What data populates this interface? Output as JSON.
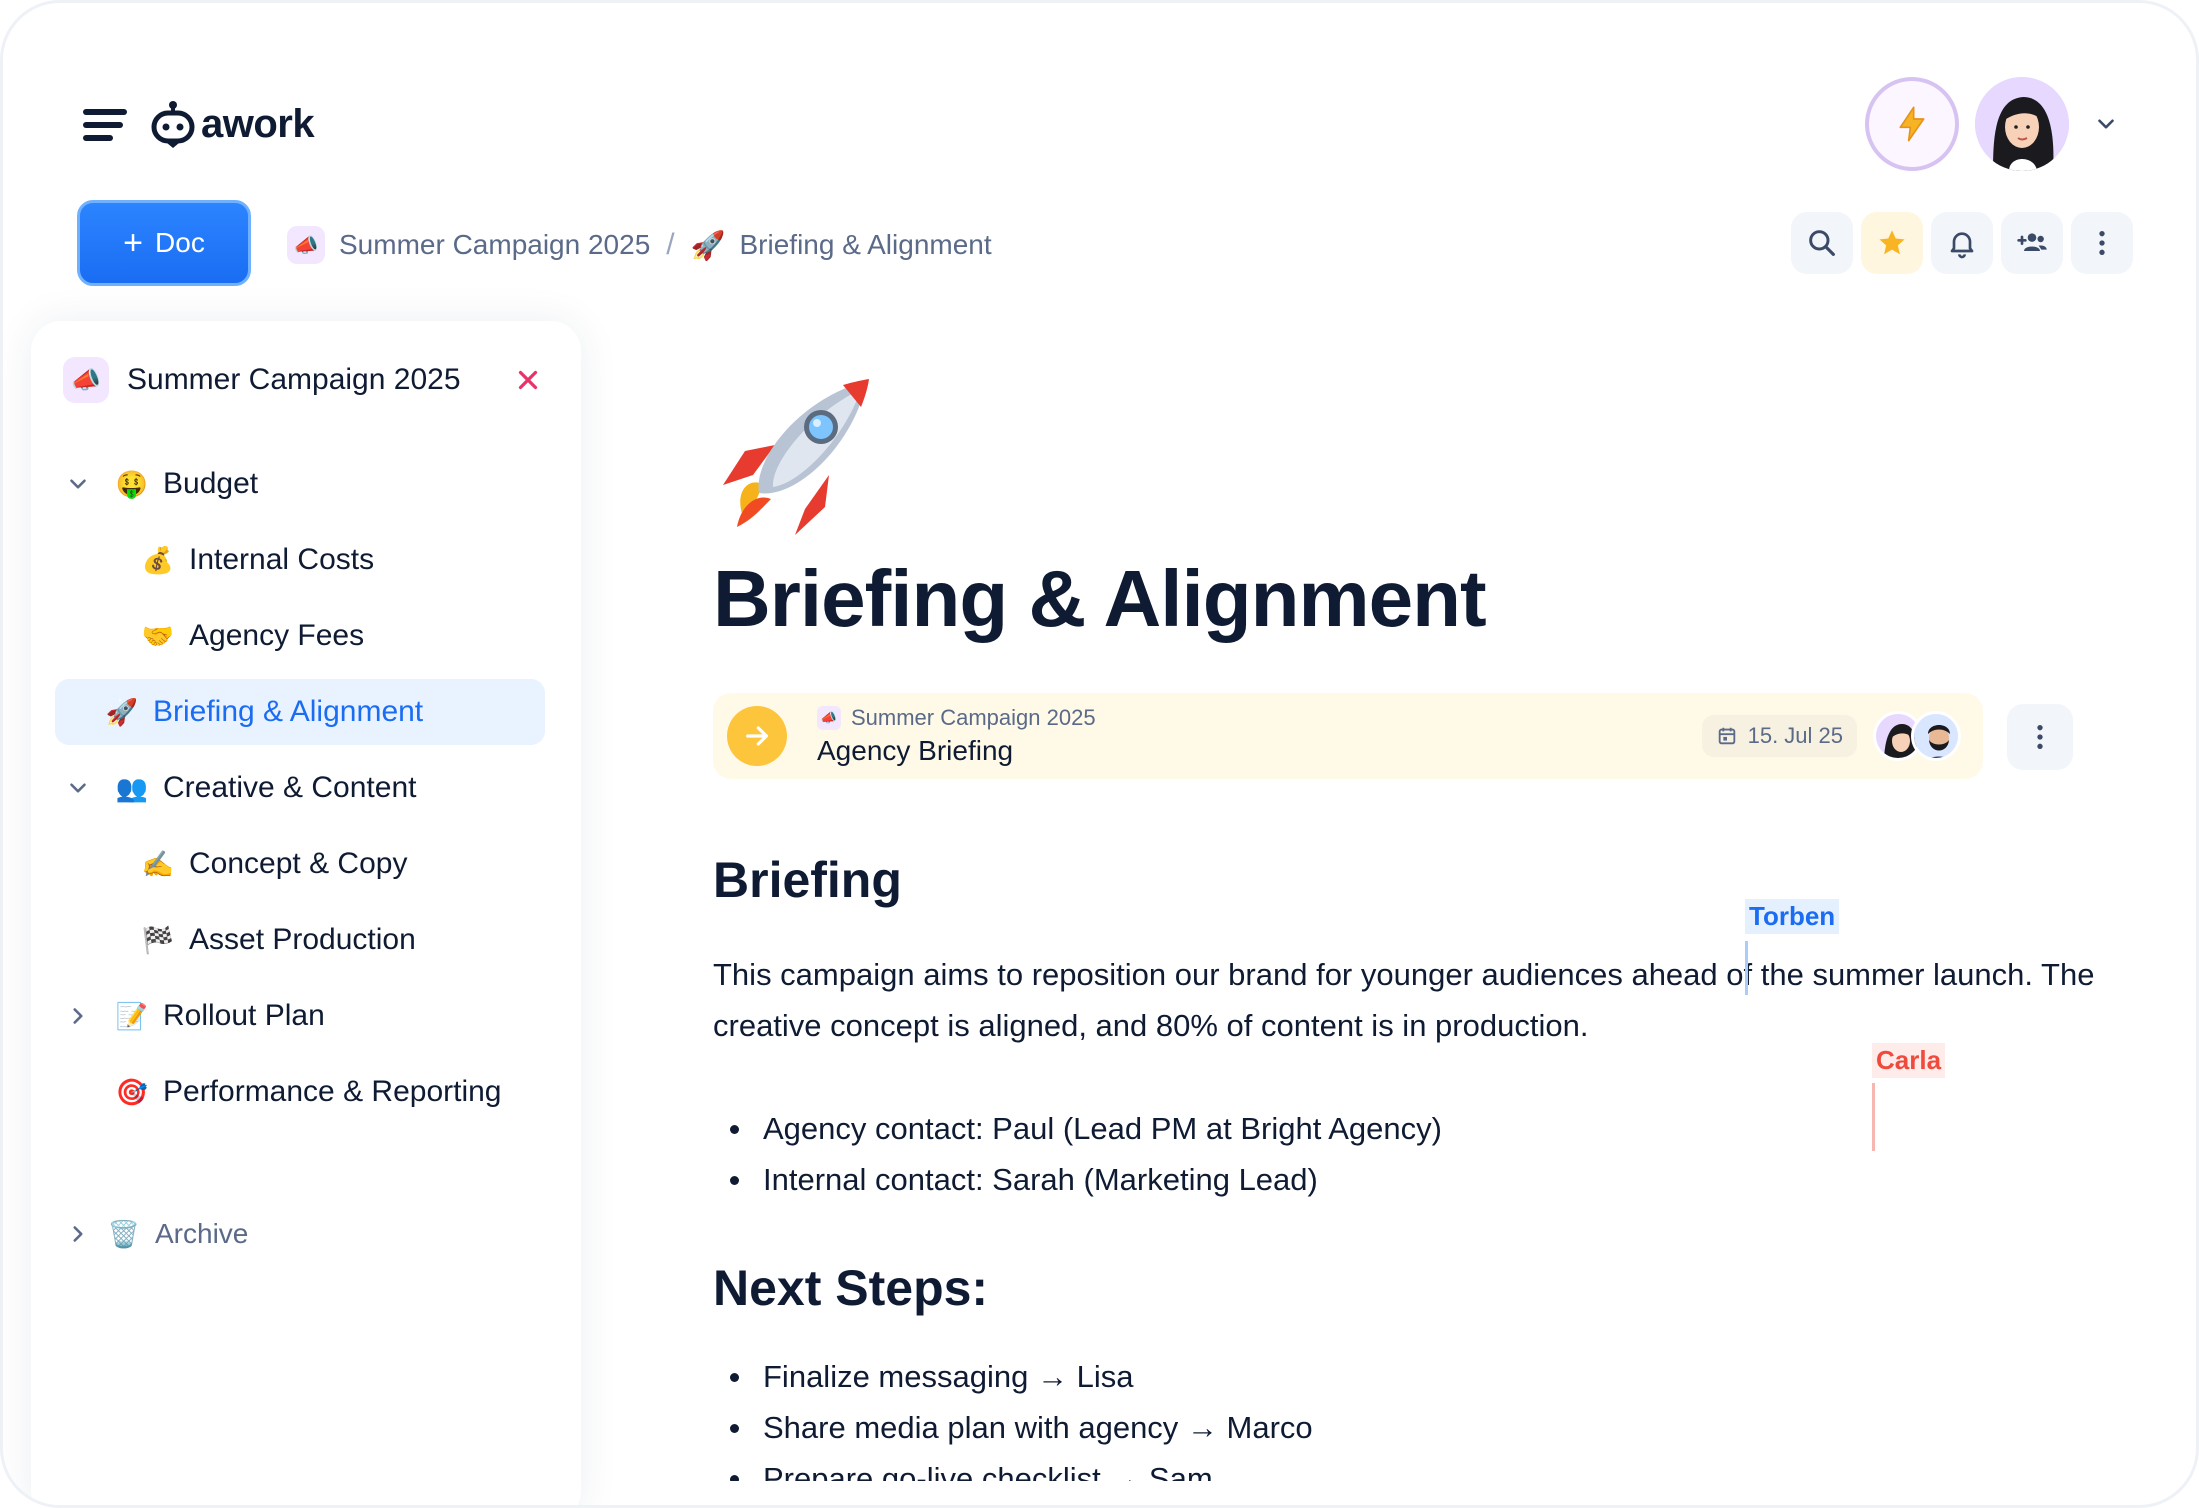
{
  "app": {
    "logo_text": "awork"
  },
  "header": {
    "new_doc_label": "Doc",
    "breadcrumb": [
      {
        "icon": "megaphone-icon",
        "emoji": "📣",
        "label": "Summer Campaign 2025"
      },
      {
        "icon": "rocket-icon",
        "emoji": "🚀",
        "label": "Briefing & Alignment"
      }
    ],
    "separator": "/",
    "tools": [
      "search-icon",
      "star-icon",
      "bell-icon",
      "add-users-icon",
      "more-vertical-icon"
    ],
    "accent": "#1a6df3"
  },
  "sidebar": {
    "project_title": "Summer Campaign 2025",
    "project_emoji": "📣",
    "items": [
      {
        "label": "Budget",
        "emoji": "🤑",
        "expanded": true
      },
      {
        "label": "Internal Costs",
        "emoji": "💰"
      },
      {
        "label": "Agency Fees",
        "emoji": "🤝"
      },
      {
        "label": "Briefing & Alignment",
        "emoji": "🚀",
        "active": true
      },
      {
        "label": "Creative & Content",
        "emoji": "👥",
        "expanded": true
      },
      {
        "label": "Concept & Copy",
        "emoji": "✍️"
      },
      {
        "label": "Asset Production",
        "emoji": "🏁"
      },
      {
        "label": "Rollout Plan",
        "emoji": "📝",
        "expanded": false
      },
      {
        "label": "Performance & Reporting",
        "emoji": "🎯"
      }
    ],
    "archive": {
      "label": "Archive",
      "emoji": "🗑️"
    }
  },
  "document": {
    "title": "Briefing & Alignment",
    "task": {
      "project": "Summer Campaign 2025",
      "name": "Agency Briefing",
      "date": "15. Jul 25"
    },
    "sections": [
      {
        "heading": "Briefing",
        "paragraph": "This campaign aims to reposition our brand for younger audiences ahead of the summer launch. The creative concept is aligned, and 80% of content is in production.",
        "bullets": [
          "Agency contact: Paul (Lead PM at Bright Agency)",
          "Internal contact: Sarah (Marketing Lead)"
        ]
      },
      {
        "heading": "Next Steps:",
        "bullets": [
          "Finalize messaging → Lisa",
          "Share media plan with agency → Marco",
          "Prepare go-live checklist → Sam"
        ]
      }
    ],
    "collaborators": [
      {
        "name": "Torben",
        "color": "#1a6df3"
      },
      {
        "name": "Carla",
        "color": "#ef4a3c"
      }
    ]
  }
}
